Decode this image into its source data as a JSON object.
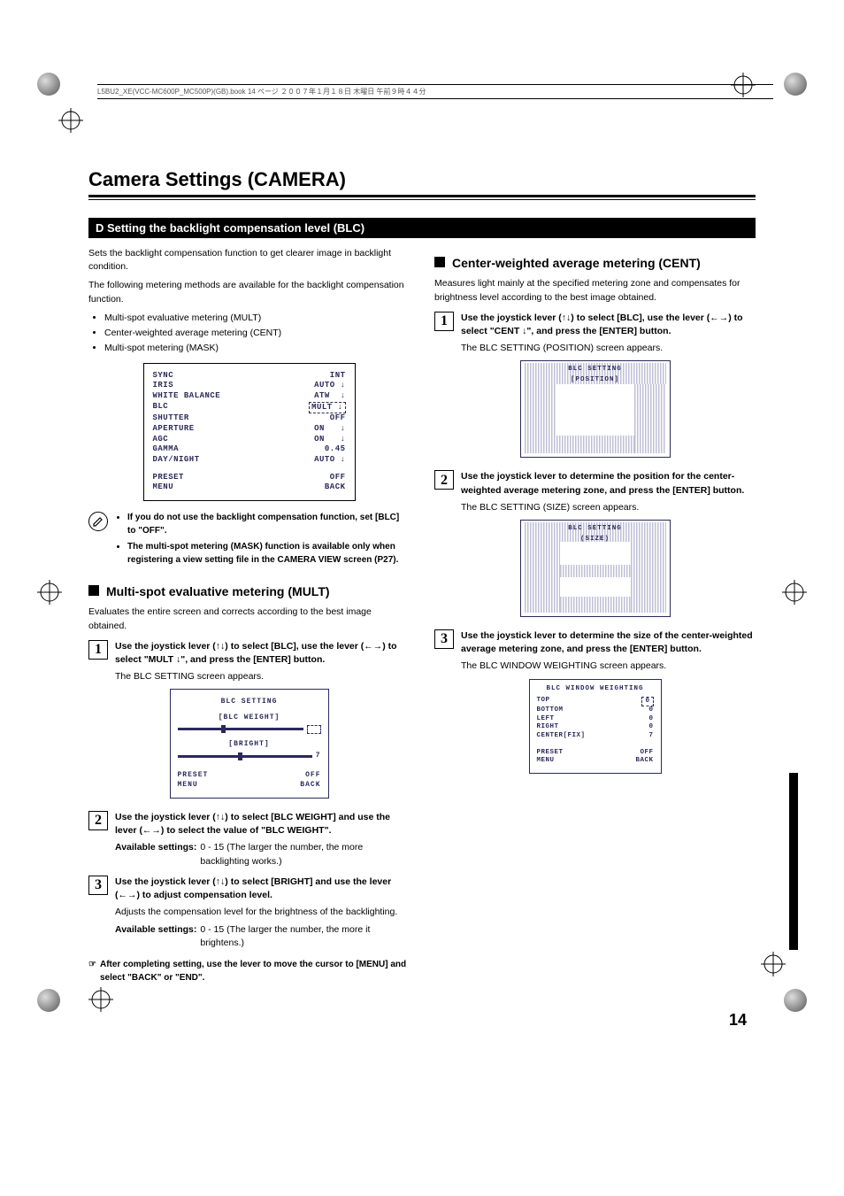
{
  "header_strip": "L5BU2_XE(VCC-MC600P_MC500P)(GB).book  14 ページ  ２００７年１月１８日  木曜日  午前９時４４分",
  "page_title": "Camera Settings (CAMERA)",
  "section_d": "D  Setting the backlight compensation level (BLC)",
  "intro_p1": "Sets the backlight compensation function to get clearer image in backlight condition.",
  "intro_p2": "The following metering methods are available for the backlight compensation function.",
  "intro_bullets": [
    "Multi-spot evaluative metering (MULT)",
    "Center-weighted average metering (CENT)",
    "Multi-spot metering (MASK)"
  ],
  "camera_menu": {
    "rows": [
      {
        "l": "SYNC",
        "r": "INT"
      },
      {
        "l": "IRIS",
        "r": "AUTO ↓"
      },
      {
        "l": "WHITE BALANCE",
        "r": "ATW  ↓"
      },
      {
        "l": "BLC",
        "r": "MULT ↓"
      },
      {
        "l": "SHUTTER",
        "r": "OFF"
      },
      {
        "l": "APERTURE",
        "r": "ON   ↓"
      },
      {
        "l": "AGC",
        "r": "ON   ↓"
      },
      {
        "l": "GAMMA",
        "r": "0.45"
      },
      {
        "l": "DAY/NIGHT",
        "r": "AUTO ↓"
      }
    ],
    "preset": {
      "l": "PRESET",
      "r": "OFF"
    },
    "menu": {
      "l": "MENU",
      "r": "BACK"
    }
  },
  "notes": [
    "If you do not use the backlight compensation function, set [BLC] to \"OFF\".",
    "The multi-spot metering (MASK) function is available only when registering a view setting file in the CAMERA VIEW screen (P27)."
  ],
  "mult": {
    "heading": "Multi-spot evaluative metering (MULT)",
    "desc": "Evaluates the entire screen and corrects according to the best image obtained.",
    "step1": {
      "bold": "Use the joystick lever (↑↓) to select [BLC], use the lever (←→) to select \"MULT ↓\", and press the [ENTER] button.",
      "reg": "The BLC SETTING screen appears."
    },
    "osd": {
      "title": "BLC SETTING",
      "row1_label": "[BLC WEIGHT]",
      "row1_val": "",
      "row2_label": "[BRIGHT]",
      "row2_val": "7",
      "preset_l": "PRESET",
      "preset_r": "OFF",
      "menu_l": "MENU",
      "menu_r": "BACK"
    },
    "step2": {
      "bold": "Use the joystick lever (↑↓) to select [BLC WEIGHT] and use the lever (←→) to select the value of \"BLC WEIGHT\".",
      "av_label": "Available settings:",
      "av_val": "0 - 15 (The larger the number, the more backlighting works.)"
    },
    "step3": {
      "bold": "Use the joystick lever (↑↓) to select [BRIGHT] and use the lever (←→) to adjust compensation level.",
      "reg": "Adjusts the compensation level for the brightness of the backlighting.",
      "av_label": "Available settings:",
      "av_val": "0 - 15 (The larger the number, the more it brightens.)"
    },
    "footnote": "After completing setting, use the lever to move the cursor to [MENU] and select \"BACK\" or \"END\"."
  },
  "cent": {
    "heading": "Center-weighted average metering (CENT)",
    "desc": "Measures light mainly at the specified metering zone and compensates for brightness level according to the best image obtained.",
    "step1": {
      "bold": "Use the joystick lever (↑↓) to select [BLC], use the lever (←→) to select \"CENT ↓\", and press the [ENTER] button.",
      "reg": "The BLC SETTING (POSITION) screen appears."
    },
    "osd1": {
      "title": "BLC SETTING",
      "sub": "[POSITION]"
    },
    "step2": {
      "bold": "Use the joystick lever to determine the position for the center-weighted average metering zone, and press the [ENTER] button.",
      "reg": "The BLC SETTING (SIZE) screen appears."
    },
    "osd2": {
      "title": "BLC SETTING",
      "sub": "(SIZE)"
    },
    "step3": {
      "bold": "Use the joystick lever to determine the size of the center-weighted average metering zone, and press the [ENTER] button.",
      "reg": "The BLC WINDOW WEIGHTING screen appears."
    },
    "osd3": {
      "title": "BLC WINDOW WEIGHTING",
      "rows": [
        {
          "l": "TOP",
          "r": "0"
        },
        {
          "l": "BOTTOM",
          "r": "0"
        },
        {
          "l": "LEFT",
          "r": "0"
        },
        {
          "l": "RIGHT",
          "r": "0"
        },
        {
          "l": "CENTER[FIX]",
          "r": "7"
        }
      ],
      "preset": {
        "l": "PRESET",
        "r": "OFF"
      },
      "menu": {
        "l": "MENU",
        "r": "BACK"
      }
    }
  },
  "page_number": "14"
}
